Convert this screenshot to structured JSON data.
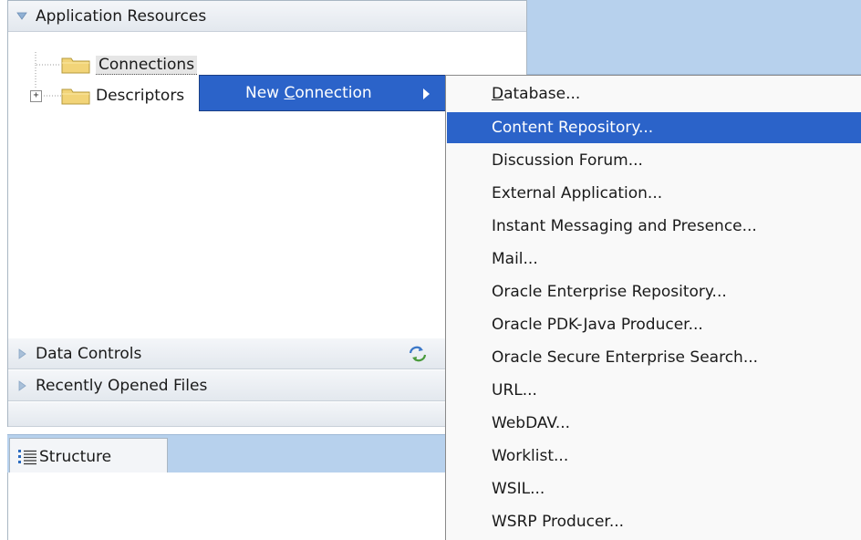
{
  "navigator": {
    "application_resources": "Application Resources",
    "tree": [
      {
        "label": "Connections"
      },
      {
        "label": "Descriptors"
      }
    ],
    "data_controls": "Data Controls",
    "recently_opened": "Recently Opened Files"
  },
  "structure": {
    "tab_label": "Structure"
  },
  "context_menu": {
    "item_label_pre": "New ",
    "item_label_mnemonic": "C",
    "item_label_post": "onnection"
  },
  "submenu": {
    "items": [
      {
        "label": "Database...",
        "mnemonic_index": 0,
        "selected": false
      },
      {
        "label": "Content Repository...",
        "selected": true
      },
      {
        "label": "Discussion Forum...",
        "selected": false
      },
      {
        "label": "External Application...",
        "selected": false
      },
      {
        "label": "Instant Messaging and Presence...",
        "selected": false
      },
      {
        "label": "Mail...",
        "selected": false
      },
      {
        "label": "Oracle Enterprise Repository...",
        "selected": false
      },
      {
        "label": "Oracle PDK-Java Producer...",
        "selected": false
      },
      {
        "label": "Oracle Secure Enterprise Search...",
        "selected": false
      },
      {
        "label": "URL...",
        "selected": false
      },
      {
        "label": "WebDAV...",
        "selected": false
      },
      {
        "label": "Worklist...",
        "selected": false
      },
      {
        "label": "WSIL...",
        "selected": false
      },
      {
        "label": "WSRP Producer...",
        "selected": false
      }
    ]
  },
  "colors": {
    "selection": "#2b63c9",
    "panel_blue": "#b7d1ed"
  },
  "icons": [
    "triangle-down-icon",
    "folder-icon",
    "expand-plus-icon",
    "triangle-right-icon",
    "refresh-icon",
    "structure-icon",
    "submenu-arrow-icon"
  ]
}
